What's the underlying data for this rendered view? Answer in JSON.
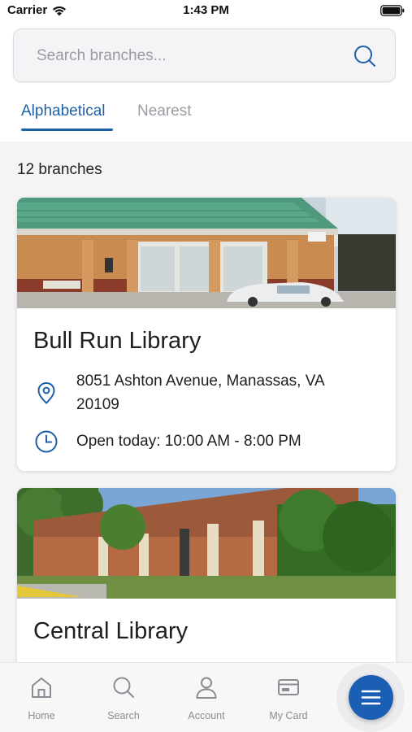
{
  "status_bar": {
    "carrier": "Carrier",
    "time": "1:43 PM"
  },
  "search": {
    "placeholder": "Search branches..."
  },
  "tabs": [
    {
      "label": "Alphabetical",
      "active": true
    },
    {
      "label": "Nearest",
      "active": false
    }
  ],
  "branch_count": "12 branches",
  "branches": [
    {
      "name": "Bull Run Library",
      "address": "8051 Ashton Avenue, Manassas, VA 20109",
      "hours": "Open today: 10:00 AM - 8:00 PM"
    },
    {
      "name": "Central Library"
    }
  ],
  "bottom_nav": [
    {
      "label": "Home",
      "icon": "home-icon"
    },
    {
      "label": "Search",
      "icon": "search-icon"
    },
    {
      "label": "Account",
      "icon": "user-icon"
    },
    {
      "label": "My Card",
      "icon": "card-icon"
    }
  ],
  "menu_button": {
    "icon": "menu-icon"
  },
  "colors": {
    "accent": "#1f5fa8",
    "fab": "#1a5fb4",
    "inactive_tab": "#9a9aa3",
    "background": "#f4f4f5"
  }
}
